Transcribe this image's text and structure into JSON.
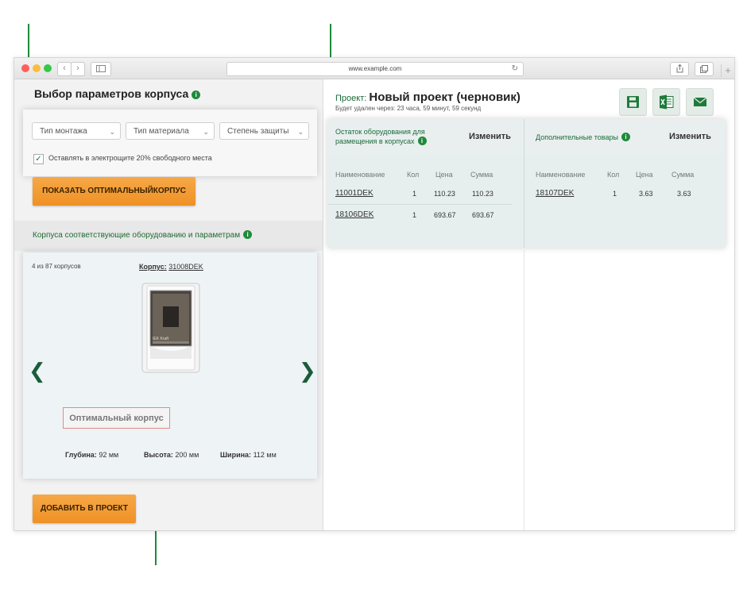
{
  "window": {
    "url": "www.example.com",
    "colors": {
      "close": "#fc605b",
      "minimize": "#fdbc40",
      "maximize": "#34c84a"
    }
  },
  "left_panel": {
    "title": "Выбор параметров корпуса",
    "selects": [
      {
        "label": "Тип монтажа"
      },
      {
        "label": "Тип материала"
      },
      {
        "label": "Степень защиты"
      }
    ],
    "checkbox": {
      "label": "Оставлять в электрощите 20% свободного места",
      "checked": true
    },
    "show_button": "ПОКАЗАТЬ ОПТИМАЛЬНЫЙКОРПУС",
    "section_title": "Корпуса соответствующие оборудованию и параметрам",
    "result": {
      "counter": "4 из 87 корпусов",
      "corpus_key": "Корпус:",
      "corpus_value": "31008DEK",
      "brand": "IEK Kraft",
      "optimal_label": "Оптимальный корпус",
      "dims": [
        {
          "label": "Глубина:",
          "value": "92 мм"
        },
        {
          "label": "Высота:",
          "value": "200 мм"
        },
        {
          "label": "Ширина:",
          "value": "112 мм"
        }
      ]
    },
    "add_button": "ДОБАВИТЬ В ПРОЕКТ"
  },
  "project": {
    "prefix": "Проект:",
    "name": "Новый проект (черновик)",
    "subtitle": "Будет удален через: 23 часа, 59 минут, 59 секунд",
    "icons": [
      "save-icon",
      "excel-icon",
      "mail-icon"
    ]
  },
  "equipment": {
    "remainder_title_line1": "Остаток оборудования для",
    "remainder_title_line2": "размещения в корпусах",
    "edit_label": "Изменить",
    "extra_title": "Дополнительные товары",
    "columns": [
      "Наименование",
      "Кол",
      "Цена",
      "Сумма"
    ],
    "remainder_rows": [
      {
        "name": "11001DEK",
        "qty": "1",
        "price": "110.23",
        "sum": "110.23"
      },
      {
        "name": "18106DEK",
        "qty": "1",
        "price": "693.67",
        "sum": "693.67"
      }
    ],
    "extra_rows": [
      {
        "name": "18107DEK",
        "qty": "1",
        "price": "3.63",
        "sum": "3.63"
      }
    ]
  }
}
